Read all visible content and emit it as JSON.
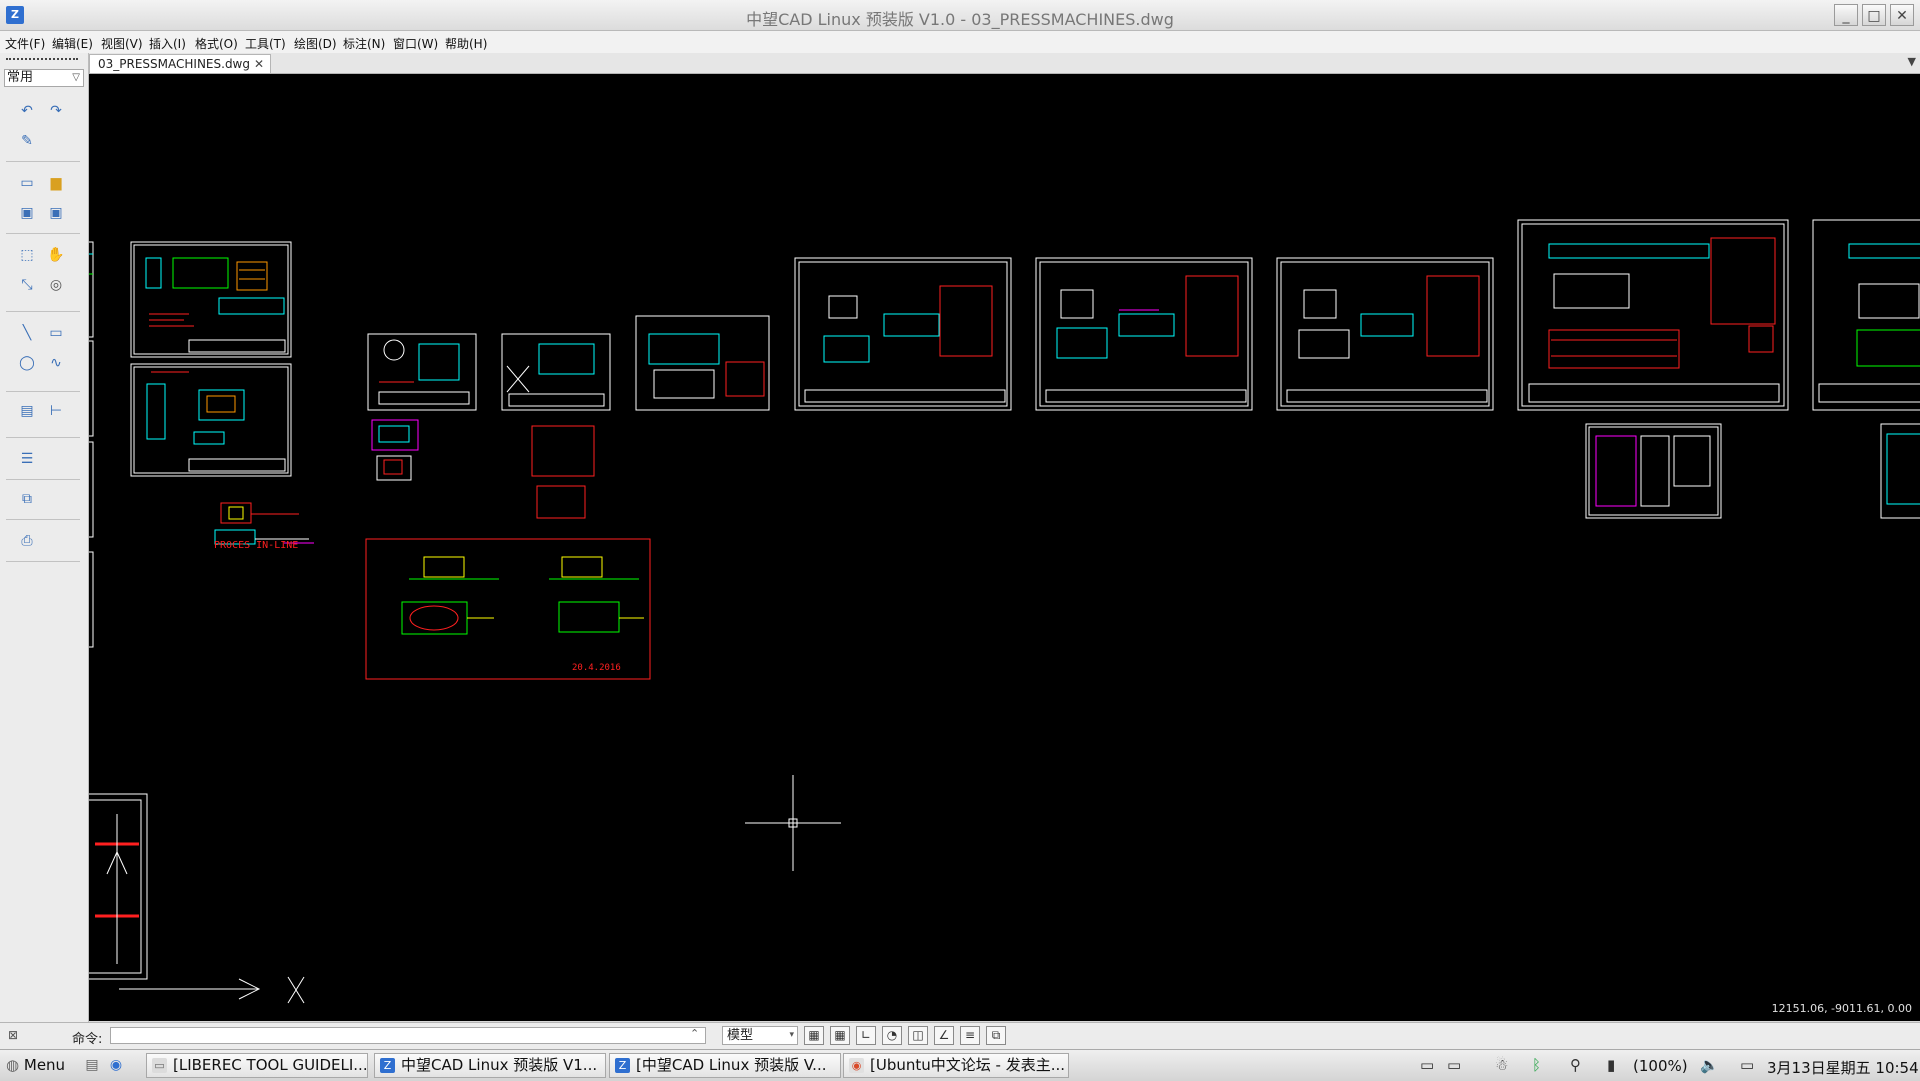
{
  "window": {
    "title": "中望CAD Linux 预装版 V1.0 - 03_PRESSMACHINES.dwg",
    "app_icon_glyph": "Z"
  },
  "menubar": {
    "items": [
      "文件(F)",
      "编辑(E)",
      "视图(V)",
      "插入(I)",
      "格式(O)",
      "工具(T)",
      "绘图(D)",
      "标注(N)",
      "窗口(W)",
      "帮助(H)"
    ]
  },
  "left_panel": {
    "workspace": "常用",
    "tools": [
      "undo-icon",
      "redo-icon",
      "match-properties-icon",
      "new-icon",
      "open-icon",
      "save-icon",
      "save-as-icon",
      "zoom-window-icon",
      "pan-icon",
      "zoom-realtime-icon",
      "orbit-icon",
      "line-icon",
      "rectangle-icon",
      "circle-icon",
      "polyline-icon",
      "text-icon",
      "dimension-icon",
      "layer-icon",
      "block-icon",
      "print-icon"
    ]
  },
  "tabs": {
    "active": "03_PRESSMACHINES.dwg",
    "close_glyph": "✕",
    "menu_glyph": "▼"
  },
  "canvas": {
    "coordinates": "12151.06, -9011.61, 0.00",
    "drawing_labels": {
      "proces_inline": "PROCES IN-LINE",
      "date_stamp": "20.4.2016",
      "x_axis": "X"
    },
    "colors": {
      "background": "#000000",
      "frame": "#ffffff",
      "cyan": "#00ffff",
      "red": "#ff2020",
      "green": "#00ff00",
      "magenta": "#ff00ff",
      "yellow": "#ffff00",
      "orange": "#ff9900"
    }
  },
  "command_bar": {
    "label": "命令:",
    "input_value": "",
    "space": "模型"
  },
  "taskbar": {
    "menu_label": "Menu",
    "tasks": [
      "[LIBEREC TOOL GUIDELI...",
      "中望CAD Linux 预装版 V1...",
      "[中望CAD Linux 预装版 V...",
      "[Ubuntu中文论坛 - 发表主..."
    ],
    "battery": "(100%)",
    "clock": "3月13日星期五 10:54"
  }
}
